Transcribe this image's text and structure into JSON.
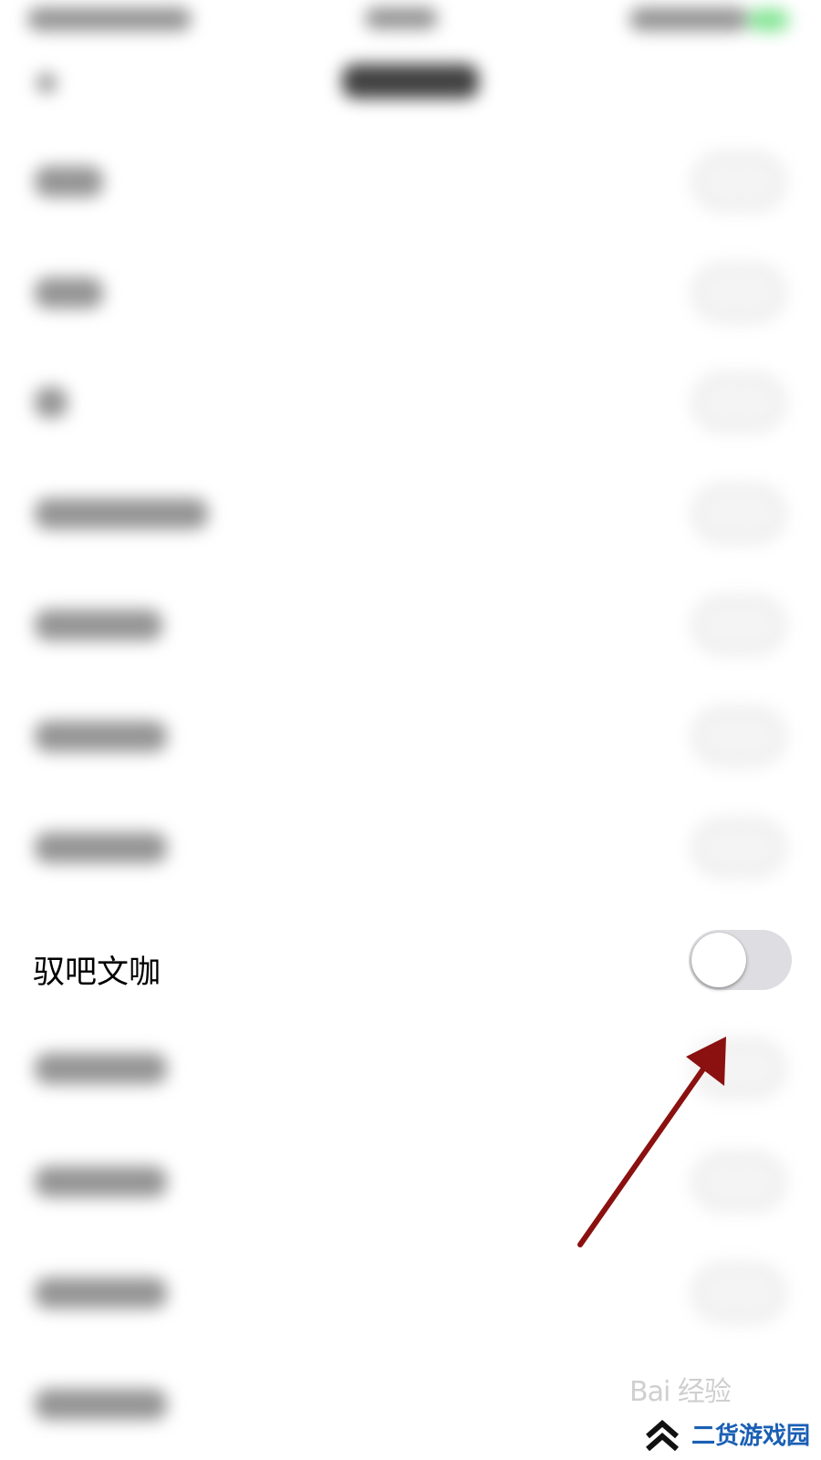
{
  "screen": {
    "visible_row_label": "驭吧文咖",
    "toggle_state": "off"
  },
  "colors": {
    "annotation_arrow": "#8b1010",
    "toggle_track_off": "#dedee2",
    "watermark_site_text": "#1a5fb4"
  },
  "watermarks": {
    "baidu": "Bai 经验",
    "site": "二货游戏园"
  }
}
